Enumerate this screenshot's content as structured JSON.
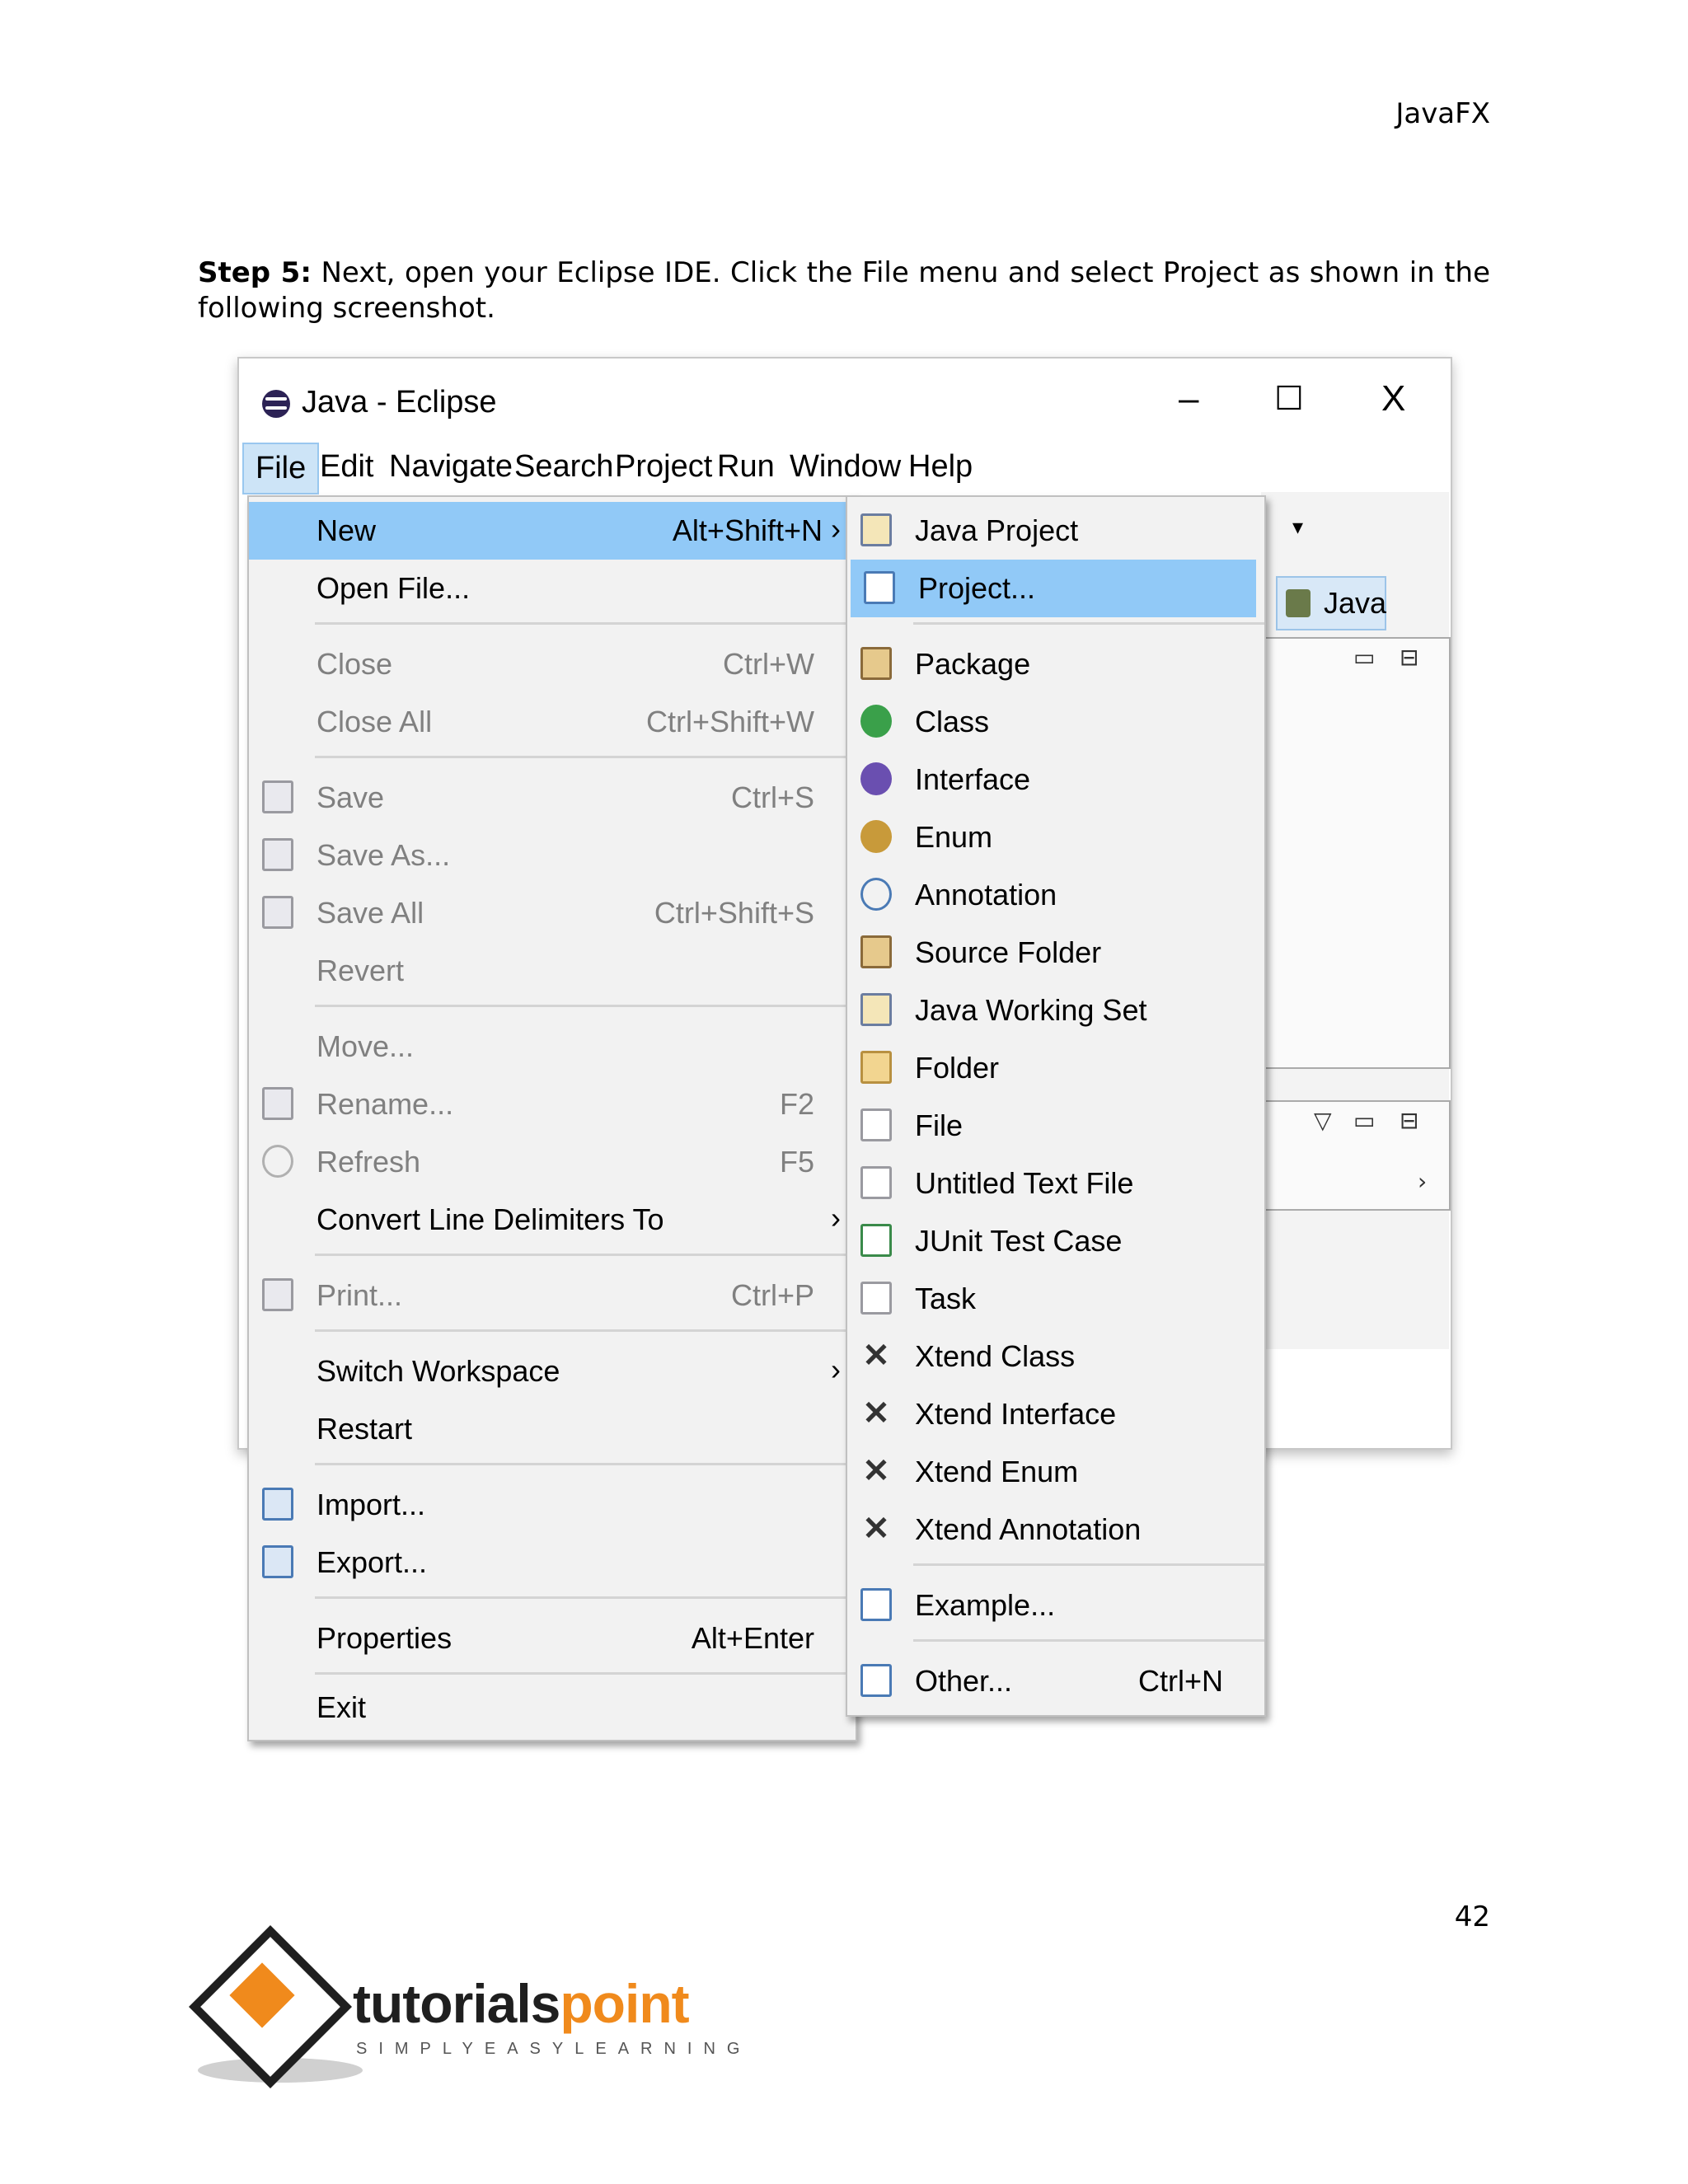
{
  "header": {
    "title": "JavaFX"
  },
  "step": {
    "label": "Step 5:",
    "text": " Next, open your Eclipse IDE. Click the File menu and select Project as shown in the following screenshot."
  },
  "window": {
    "title": "Java - Eclipse",
    "minimize": "–",
    "maximize": "☐",
    "close": "X"
  },
  "menubar": [
    "File",
    "Edit",
    "Navigate",
    "Search",
    "Project",
    "Run",
    "Window",
    "Help"
  ],
  "perspective": {
    "label": "Java"
  },
  "file_menu": [
    {
      "label": "New",
      "shortcut": "Alt+Shift+N",
      "arrow": "›"
    },
    {
      "label": "Open File..."
    },
    {
      "label": "Close",
      "shortcut": "Ctrl+W"
    },
    {
      "label": "Close All",
      "shortcut": "Ctrl+Shift+W"
    },
    {
      "label": "Save",
      "shortcut": "Ctrl+S"
    },
    {
      "label": "Save As..."
    },
    {
      "label": "Save All",
      "shortcut": "Ctrl+Shift+S"
    },
    {
      "label": "Revert"
    },
    {
      "label": "Move..."
    },
    {
      "label": "Rename...",
      "shortcut": "F2"
    },
    {
      "label": "Refresh",
      "shortcut": "F5"
    },
    {
      "label": "Convert Line Delimiters To",
      "arrow": "›"
    },
    {
      "label": "Print...",
      "shortcut": "Ctrl+P"
    },
    {
      "label": "Switch Workspace",
      "arrow": "›"
    },
    {
      "label": "Restart"
    },
    {
      "label": "Import..."
    },
    {
      "label": "Export..."
    },
    {
      "label": "Properties",
      "shortcut": "Alt+Enter"
    },
    {
      "label": "Exit"
    }
  ],
  "new_menu": [
    {
      "label": "Java Project"
    },
    {
      "label": "Project..."
    },
    {
      "label": "Package"
    },
    {
      "label": "Class"
    },
    {
      "label": "Interface"
    },
    {
      "label": "Enum"
    },
    {
      "label": "Annotation"
    },
    {
      "label": "Source Folder"
    },
    {
      "label": "Java Working Set"
    },
    {
      "label": "Folder"
    },
    {
      "label": "File"
    },
    {
      "label": "Untitled Text File"
    },
    {
      "label": "JUnit Test Case"
    },
    {
      "label": "Task"
    },
    {
      "label": "Xtend Class"
    },
    {
      "label": "Xtend Interface"
    },
    {
      "label": "Xtend Enum"
    },
    {
      "label": "Xtend Annotation"
    },
    {
      "label": "Example..."
    },
    {
      "label": "Other...",
      "shortcut": "Ctrl+N"
    }
  ],
  "ide": {
    "arrow_down": "▾",
    "view_menu": "▽",
    "min": "▭",
    "max": "⊟",
    "chevron": "›"
  },
  "page_number": "42",
  "logo": {
    "word_a": "tutorials",
    "word_b": "point",
    "tagline": "SIMPLYEASYLEARNING"
  },
  "colors": {
    "selection": "#91c9f7",
    "menu_bg": "#f2f2f2",
    "logo_orange": "#f08a1c"
  }
}
